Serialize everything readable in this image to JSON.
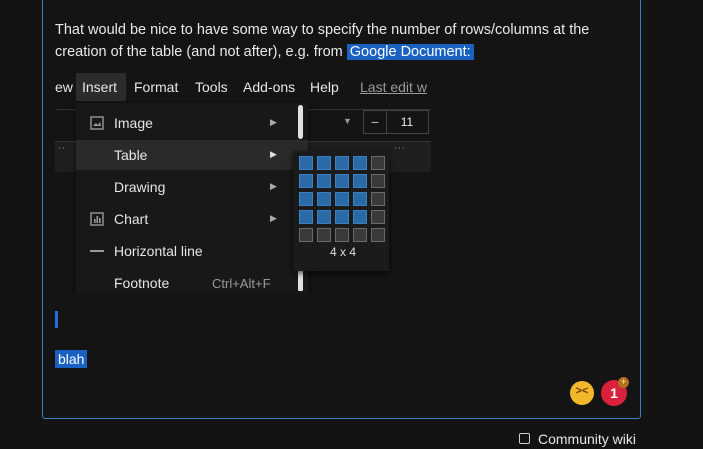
{
  "post": {
    "text_before": "That would be nice to have some way to specify the number of rows/columns at the creation of the table (and not after), e.g. from ",
    "link_text": "Google Document:",
    "blah": "blah"
  },
  "gdocs": {
    "menubar": {
      "partial_view": "ew",
      "insert": "Insert",
      "format": "Format",
      "tools": "Tools",
      "addons": "Add-ons",
      "help": "Help",
      "last_edit": "Last edit w"
    },
    "font_size": "11",
    "font_size_minus": "−",
    "insert_menu": [
      {
        "label": "Image",
        "icon": "image-icon",
        "has_submenu": true
      },
      {
        "label": "Table",
        "icon": "",
        "has_submenu": true
      },
      {
        "label": "Drawing",
        "icon": "",
        "has_submenu": true
      },
      {
        "label": "Chart",
        "icon": "chart-icon",
        "has_submenu": true
      },
      {
        "label": "Horizontal line",
        "icon": "horizontal-line-icon",
        "has_submenu": false
      },
      {
        "label": "Footnote",
        "icon": "",
        "shortcut": "Ctrl+Alt+F",
        "has_submenu": false
      }
    ],
    "table_picker": {
      "rows_selected": 4,
      "cols_selected": 4,
      "label": "4 x 4"
    }
  },
  "reactions": {
    "emoji": "confounded-face",
    "count": "1",
    "plus": "+"
  },
  "community_wiki": {
    "label": "Community wiki",
    "checked": false
  },
  "colors": {
    "accent": "#3b7fc4",
    "highlight": "#1a62c2",
    "badge": "#d9213b"
  }
}
